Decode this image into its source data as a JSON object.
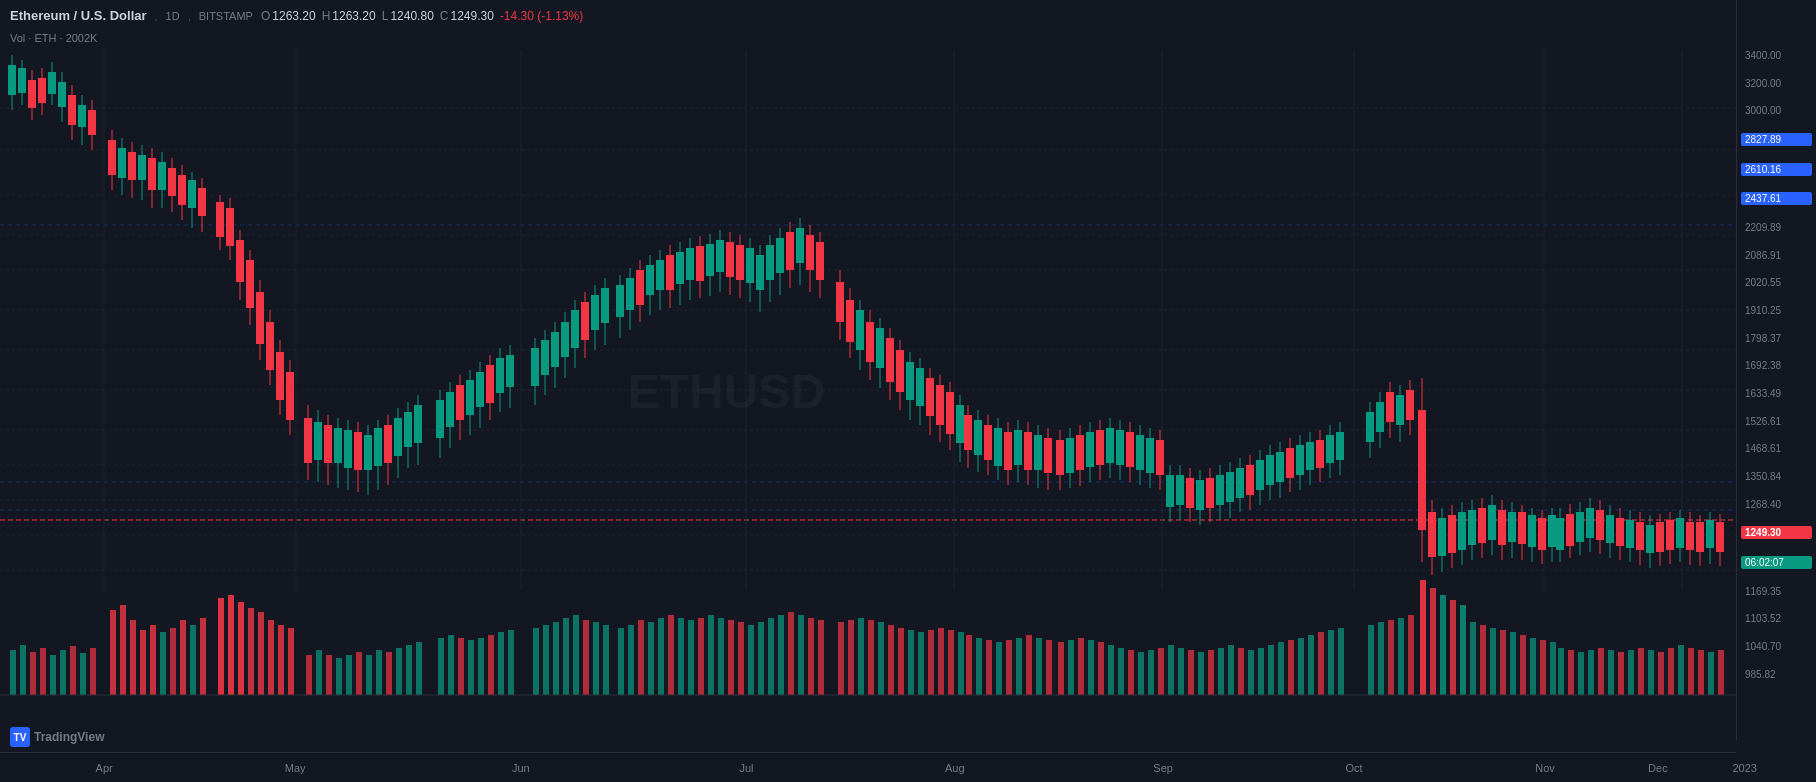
{
  "header": {
    "title": "Ethereum / U.S. Dollar",
    "timeframe": "1D",
    "exchange": "BITSTAMP",
    "open_label": "O",
    "open_value": "1263.20",
    "high_label": "H",
    "high_value": "1263.20",
    "low_label": "L",
    "low_value": "1240.80",
    "close_label": "C",
    "close_value": "1249.30",
    "change_value": "-14.30 (-1.13%)",
    "vol_label": "Vol · ETH · 2002K"
  },
  "currency_label": "USD",
  "price_levels": [
    {
      "value": "3400.00",
      "type": "normal"
    },
    {
      "value": "3200.00",
      "type": "normal"
    },
    {
      "value": "3000.00",
      "type": "normal"
    },
    {
      "value": "2827.89",
      "type": "blue"
    },
    {
      "value": "2610.16",
      "type": "blue"
    },
    {
      "value": "2437.61",
      "type": "blue"
    },
    {
      "value": "2209.89",
      "type": "normal"
    },
    {
      "value": "2086.91",
      "type": "normal"
    },
    {
      "value": "2020.55",
      "type": "normal"
    },
    {
      "value": "1910.25",
      "type": "normal"
    },
    {
      "value": "1798.37",
      "type": "normal"
    },
    {
      "value": "1692.38",
      "type": "normal"
    },
    {
      "value": "1633.49",
      "type": "normal"
    },
    {
      "value": "1526.61",
      "type": "normal"
    },
    {
      "value": "1468.61",
      "type": "normal"
    },
    {
      "value": "1350.84",
      "type": "normal"
    },
    {
      "value": "1268.40",
      "type": "normal"
    },
    {
      "value": "1249.30",
      "type": "red"
    },
    {
      "value": "06:02:07",
      "type": "teal"
    },
    {
      "value": "1169.35",
      "type": "normal"
    },
    {
      "value": "1103.52",
      "type": "normal"
    },
    {
      "value": "1040.70",
      "type": "normal"
    },
    {
      "value": "985.82",
      "type": "normal"
    }
  ],
  "time_labels": [
    {
      "label": "Apr",
      "pct": 6
    },
    {
      "label": "May",
      "pct": 17
    },
    {
      "label": "Jun",
      "pct": 30
    },
    {
      "label": "Jul",
      "pct": 43
    },
    {
      "label": "Aug",
      "pct": 55
    },
    {
      "label": "Sep",
      "pct": 67
    },
    {
      "label": "Oct",
      "pct": 78
    },
    {
      "label": "Nov",
      "pct": 89
    },
    {
      "label": "Dec",
      "pct": 97
    },
    {
      "label": "2023",
      "pct": 102
    }
  ],
  "tv_logo": "📊 TradingView"
}
